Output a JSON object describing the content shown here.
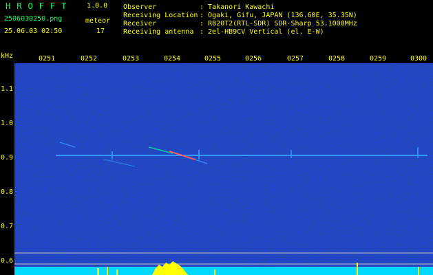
{
  "header": {
    "app_title": "HROFFT",
    "version": "1.0.0",
    "file_name": "2506030250.png",
    "date_time": "25.06.03 02:50",
    "meteor_label": "meteor",
    "meteor_count": "17",
    "info": [
      {
        "label": "Observer",
        "value": ": Takanori Kawachi"
      },
      {
        "label": "Receiving Location",
        "value": ": Ogaki, Gifu, JAPAN (136.60E, 35.35N)"
      },
      {
        "label": "Receiver",
        "value": ": R820T2(RTL-SDR) SDR-Sharp 53.1000MHz"
      },
      {
        "label": "Receiving antenna",
        "value": ": 2el-HB9CV Vertical (el. E-W)"
      }
    ]
  },
  "axis": {
    "unit": "kHz",
    "time_ticks": [
      "0251",
      "0252",
      "0253",
      "0254",
      "0255",
      "0256",
      "0257",
      "0258",
      "0259",
      "0300"
    ],
    "freq_ticks": [
      "1.1",
      "1.0",
      "0.9",
      "0.8",
      "0.7",
      "0.6"
    ]
  },
  "colors": {
    "background": "#000000",
    "text_primary": "#ffff00",
    "text_title": "#00ff66",
    "noise": "#0a1a6e",
    "carrier": "#3aa0ff",
    "meteor_echo": "#ff6060",
    "power_strip": "#00d8ff",
    "power_peak": "#ffff00"
  }
}
